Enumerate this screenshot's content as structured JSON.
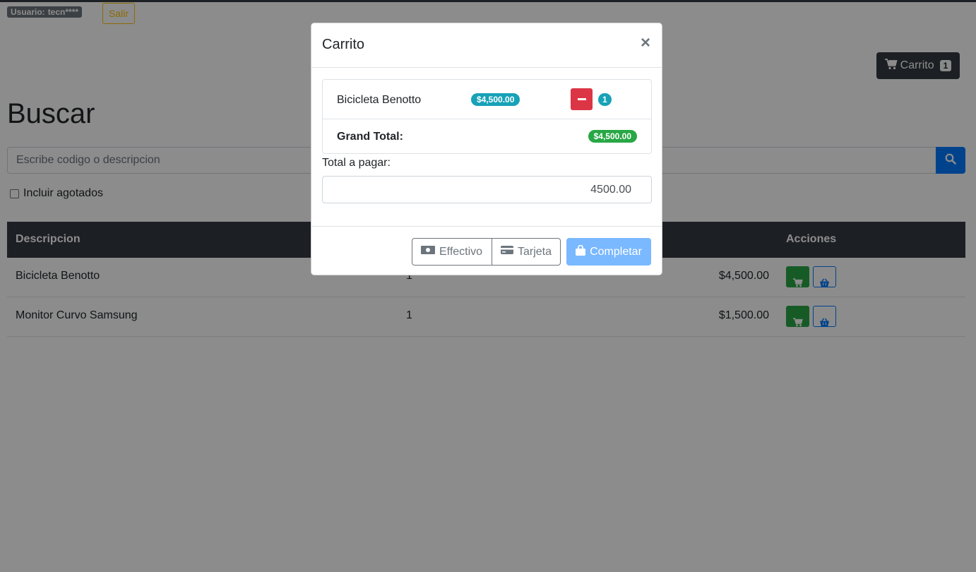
{
  "header": {
    "user_label": "Usuario:",
    "user_name": "tecn****",
    "logout_label": "Salir",
    "cart_label": "Carrito",
    "cart_count": "1"
  },
  "search": {
    "title": "Buscar",
    "placeholder": "Escribe codigo o descripcion",
    "include_out_of_stock_label": "Incluir agotados"
  },
  "table": {
    "headers": {
      "descripcion": "Descripcion",
      "acciones": "Acciones"
    },
    "rows": [
      {
        "descripcion": "Bicicleta Benotto",
        "cantidad": "1",
        "precio": "$4,500.00"
      },
      {
        "descripcion": "Monitor Curvo Samsung",
        "cantidad": "1",
        "precio": "$1,500.00"
      }
    ]
  },
  "modal": {
    "title": "Carrito",
    "close_label": "×",
    "items": [
      {
        "name": "Bicicleta Benotto",
        "price": "$4,500.00",
        "qty": "1"
      }
    ],
    "grand_total_label": "Grand Total:",
    "grand_total": "$4,500.00",
    "total_label": "Total a pagar:",
    "total_value": "4500.00",
    "cash_label": "Effectivo",
    "card_label": "Tarjeta",
    "complete_label": "Completar"
  },
  "colors": {
    "primary": "#007bff",
    "success": "#28a745",
    "danger": "#dc3545",
    "info": "#17a2b8",
    "warning": "#ffc107",
    "dark": "#343a40"
  },
  "icons": {
    "cart": "shopping-cart-icon",
    "search": "search-icon",
    "basket": "basket-icon",
    "cash": "money-bill-icon",
    "card": "credit-card-icon",
    "bag": "shopping-bag-icon",
    "minus": "minus-icon",
    "close": "close-icon"
  }
}
